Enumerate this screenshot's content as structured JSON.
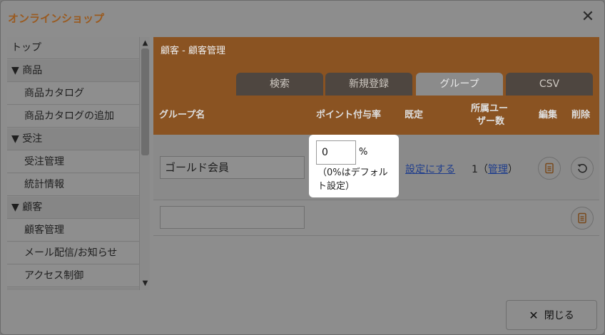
{
  "window": {
    "title": "オンラインショップ"
  },
  "sidebar": {
    "items": [
      {
        "label": "トップ",
        "kind": "item-top"
      },
      {
        "label": "▼ 商品",
        "kind": "cat"
      },
      {
        "label": "商品カタログ",
        "kind": "item"
      },
      {
        "label": "商品カタログの追加",
        "kind": "item"
      },
      {
        "label": "▼ 受注",
        "kind": "cat"
      },
      {
        "label": "受注管理",
        "kind": "item"
      },
      {
        "label": "統計情報",
        "kind": "item"
      },
      {
        "label": "▼ 顧客",
        "kind": "cat"
      },
      {
        "label": "顧客管理",
        "kind": "item"
      },
      {
        "label": "メール配信/お知らせ",
        "kind": "item"
      },
      {
        "label": "アクセス制御",
        "kind": "item"
      }
    ]
  },
  "main": {
    "breadcrumb": "顧客 - 顧客管理",
    "tabs": [
      {
        "label": "検索"
      },
      {
        "label": "新規登録"
      },
      {
        "label": "グループ",
        "active": true
      },
      {
        "label": "CSV"
      }
    ],
    "columns": {
      "group_name": "グループ名",
      "point_rate": "ポイント付与率",
      "default": "既定",
      "members_line1": "所属ユー",
      "members_line2": "ザー数",
      "edit": "編集",
      "delete": "削除"
    },
    "rows": [
      {
        "group_name": "ゴールド会員",
        "set_default_link": "設定にする",
        "count_prefix": "1（",
        "manage_link": "管理",
        "count_suffix": "）"
      },
      {
        "group_name": ""
      }
    ],
    "popup": {
      "value": "0",
      "unit": "%",
      "note": "（0%はデフォルト設定）"
    }
  },
  "footer": {
    "close_label": "閉じる"
  },
  "colors": {
    "accent": "#8a5322",
    "link": "#1f3d8c"
  }
}
